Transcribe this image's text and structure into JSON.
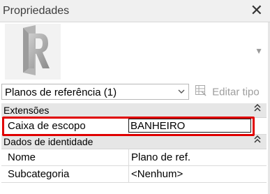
{
  "panel": {
    "title": "Propriedades",
    "close_symbol": "✕",
    "preview_icon": "revit-logo-icon",
    "expand_symbol": "▼"
  },
  "type_selector": {
    "selected": "Planos de referência (1)",
    "edit_type_label": "Editar tipo"
  },
  "sections": [
    {
      "label": "Extensões",
      "rows": [
        {
          "name": "Caixa de escopo",
          "value": "BANHEIRO",
          "editing": true
        }
      ]
    },
    {
      "label": "Dados de identidade",
      "rows": [
        {
          "name": "Nome",
          "value": "Plano de ref."
        },
        {
          "name": "Subcategoria",
          "value": "<Nenhum>"
        }
      ]
    }
  ],
  "colors": {
    "highlight": "#e00000",
    "section_bg": "#e6e6e6",
    "disabled_text": "#9d9d9d"
  }
}
